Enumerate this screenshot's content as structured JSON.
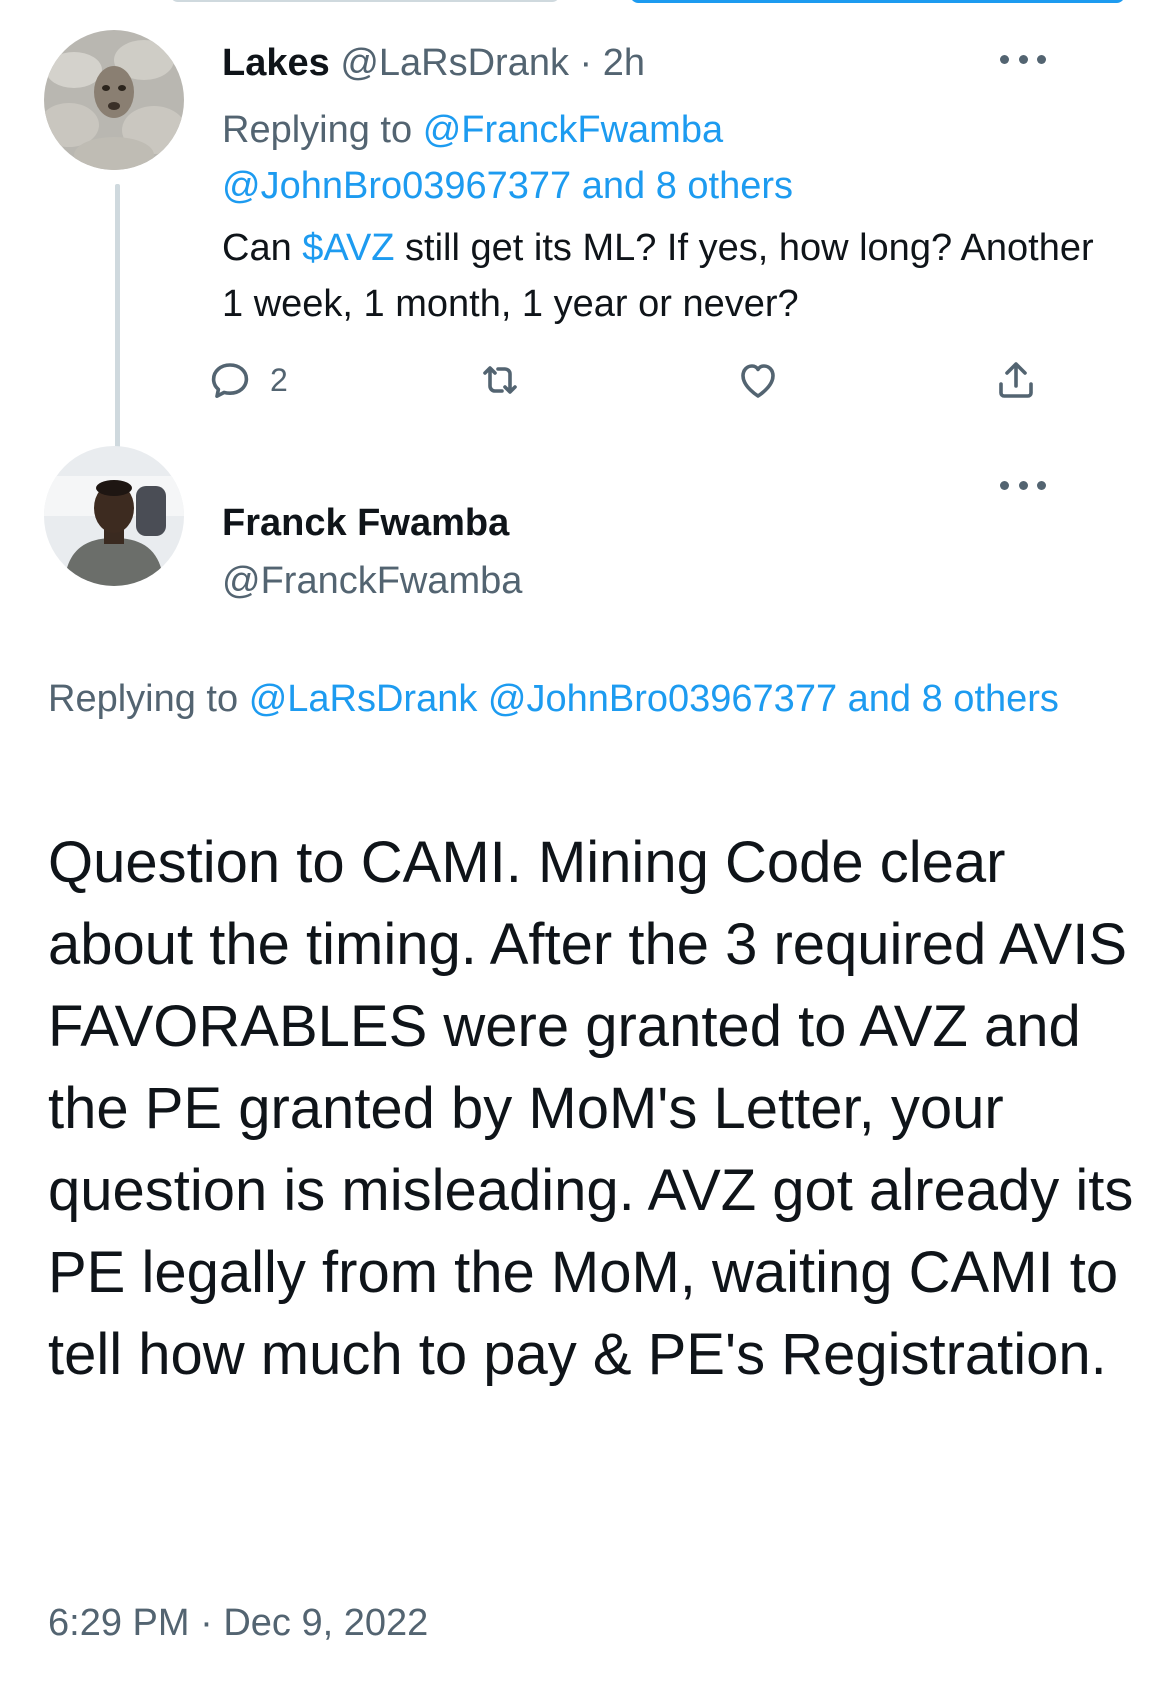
{
  "colors": {
    "accent": "#1d9bf0",
    "muted": "#536471",
    "text": "#0f1419",
    "divider": "#cfd9de"
  },
  "tweet_parent": {
    "author_name": "Lakes",
    "author_handle": "@LaRsDrank",
    "separator": "·",
    "time_ago": "2h",
    "replying_prefix": "Replying to",
    "replying_user_1": "@FranckFwamba",
    "replying_user_2": "@JohnBro03967377",
    "replying_others": "and 8 others",
    "body_before": "Can ",
    "body_cashtag": "$AVZ",
    "body_after": " still get its ML? If yes, how long? Another 1 week, 1 month, 1 year or never?",
    "reply_count": "2",
    "icons": [
      "reply-icon",
      "retweet-icon",
      "like-icon",
      "share-icon",
      "more-icon"
    ]
  },
  "tweet_main": {
    "author_name": "Franck Fwamba",
    "author_handle": "@FranckFwamba",
    "replying_prefix": "Replying to",
    "replying_user_1": "@LaRsDrank",
    "replying_user_2": "@JohnBro03967377",
    "replying_others": "and 8 others",
    "body": "Question to CAMI. Mining Code clear about the timing. After the 3 required AVIS FAVORABLES were granted to AVZ and the PE granted by MoM's Letter, your question is misleading. AVZ got already its PE legally from the MoM, waiting CAMI to tell how much to pay & PE's Registration.",
    "time": "6:29 PM",
    "separator": "·",
    "date": "Dec 9, 2022"
  }
}
